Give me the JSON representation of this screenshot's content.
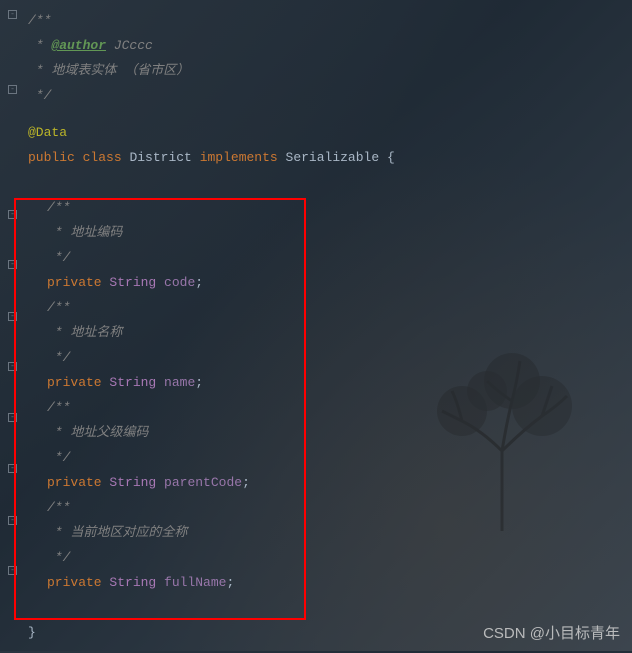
{
  "header": {
    "doc_open": "/**",
    "author_tag": "@author",
    "author_name": " JCccc",
    "description": " * 地域表实体 （省市区）",
    "doc_close": " */"
  },
  "annotation": "@Data",
  "class_decl": {
    "modifier": "public",
    "class_kw": "class",
    "name": "District",
    "implements_kw": "implements",
    "interface": "Serializable",
    "brace": " {"
  },
  "fields": [
    {
      "doc_open": "/**",
      "doc_body": " * 地址编码",
      "doc_close": " */",
      "modifier": "private",
      "type": "String",
      "name": "code",
      "semi": ";"
    },
    {
      "doc_open": "/**",
      "doc_body": " * 地址名称",
      "doc_close": " */",
      "modifier": "private",
      "type": "String",
      "name": "name",
      "semi": ";"
    },
    {
      "doc_open": "/**",
      "doc_body": " * 地址父级编码",
      "doc_close": " */",
      "modifier": "private",
      "type": "String",
      "name": "parentCode",
      "semi": ";"
    },
    {
      "doc_open": "/**",
      "doc_body": " * 当前地区对应的全称",
      "doc_close": " */",
      "modifier": "private",
      "type": "String",
      "name": "fullName",
      "semi": ";"
    }
  ],
  "class_close": "}",
  "watermark": "CSDN @小目标青年"
}
